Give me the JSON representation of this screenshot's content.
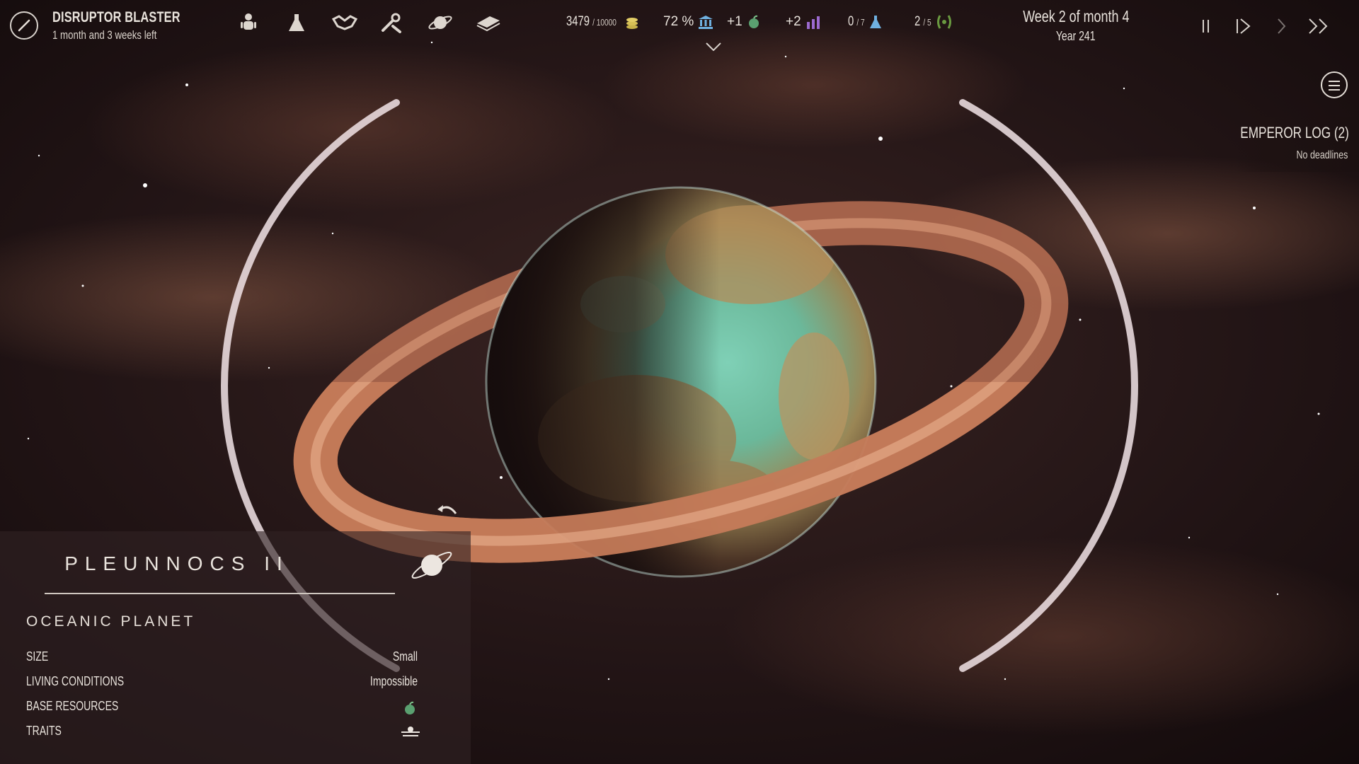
{
  "ship": {
    "name": "DISRUPTOR BLASTER",
    "time_left": "1 month and 3 weeks left"
  },
  "nav_icons": [
    "population-icon",
    "research-flask-icon",
    "diplomacy-handshake-icon",
    "build-tools-icon",
    "planet-ring-icon",
    "codex-book-icon"
  ],
  "resources": {
    "credits": {
      "value": "3479",
      "max": "/ 10000"
    },
    "approval": {
      "value": "72 %"
    },
    "food": {
      "value": "+1"
    },
    "industry": {
      "value": "+2"
    },
    "research": {
      "value": "0",
      "max": "/ 7"
    },
    "influence": {
      "value": "2",
      "max": "/ 5"
    }
  },
  "date": {
    "week": "Week 2 of month 4",
    "year": "Year 241"
  },
  "emperor_log": {
    "title": "EMPEROR LOG (2)",
    "subtitle": "No deadlines"
  },
  "planet": {
    "name": "PLEUNNOCS II",
    "type": "OCEANIC PLANET",
    "rows": [
      {
        "label": "SIZE",
        "value": "Small"
      },
      {
        "label": "LIVING CONDITIONS",
        "value": "Impossible"
      },
      {
        "label": "BASE RESOURCES",
        "value": ""
      },
      {
        "label": "TRAITS",
        "value": ""
      }
    ]
  },
  "colors": {
    "ring": "#c47a58",
    "ocean": "#5fb8a0",
    "land": "#b08a55",
    "food": "#5aa070",
    "industry": "#9c6ad0",
    "approval": "#6fb0e0",
    "influence": "#6a9a40"
  }
}
